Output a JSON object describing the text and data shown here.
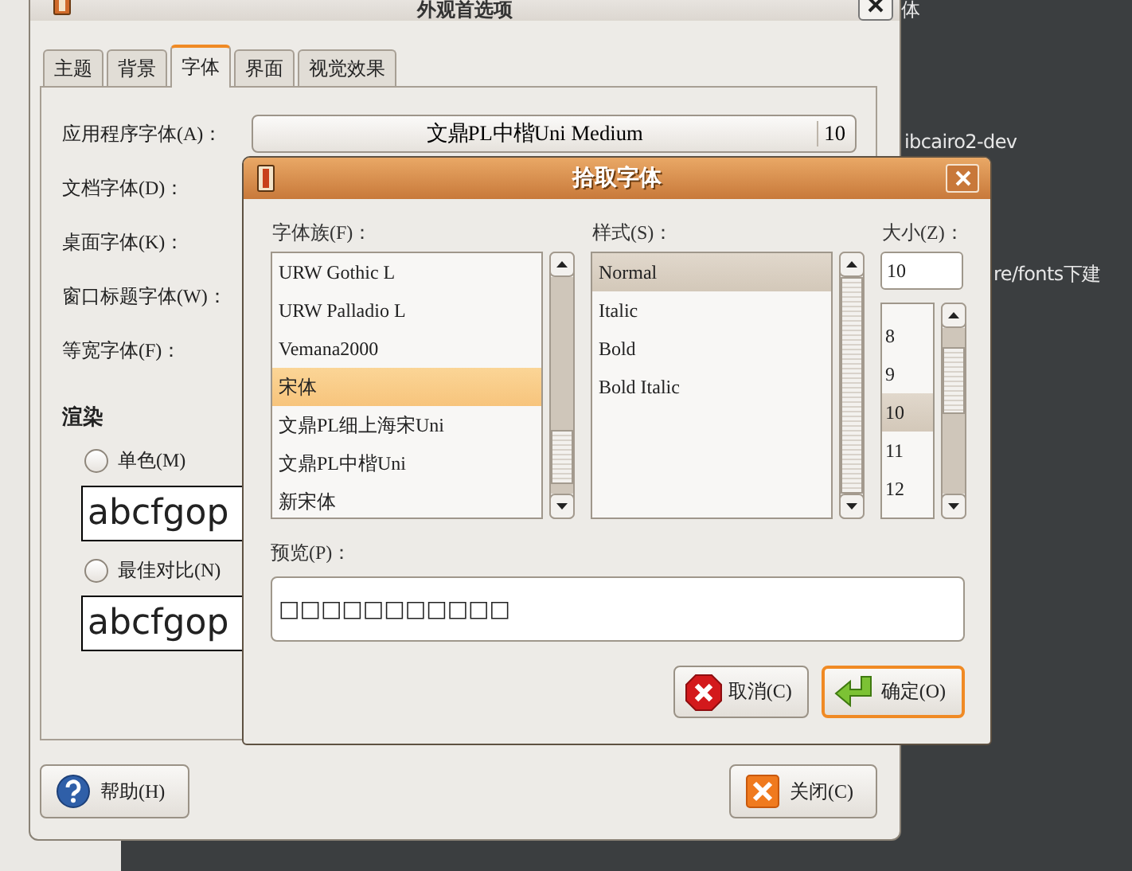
{
  "desktop_text": [
    "体",
    "ibcairo2-dev",
    "re/fonts下建"
  ],
  "main_window": {
    "title": "外观首选项",
    "tabs": [
      {
        "label": "主题",
        "selected": false
      },
      {
        "label": "背景",
        "selected": false
      },
      {
        "label": "字体",
        "selected": true
      },
      {
        "label": "界面",
        "selected": false
      },
      {
        "label": "视觉效果",
        "selected": false
      }
    ],
    "font_rows": [
      {
        "label": "应用程序字体(A)：",
        "value": "文鼎PL中楷Uni Medium",
        "size": "10"
      },
      {
        "label": "文档字体(D)："
      },
      {
        "label": "桌面字体(K)："
      },
      {
        "label": "窗口标题字体(W)："
      },
      {
        "label": "等宽字体(F)："
      }
    ],
    "rendering": {
      "heading": "渲染",
      "options": [
        {
          "label": "单色(M)",
          "selected": false,
          "sample": "abcfgop"
        },
        {
          "label": "最佳对比(N)",
          "selected": false,
          "sample": "abcfgop"
        }
      ]
    },
    "buttons": [
      {
        "label": "帮助(H)",
        "kind": "help"
      },
      {
        "label": "关闭(C)",
        "kind": "close"
      }
    ]
  },
  "dialog": {
    "title": "拾取字体",
    "family": {
      "label": "字体族(F)：",
      "items": [
        {
          "name": "URW Gothic L",
          "selected": false
        },
        {
          "name": "URW Palladio L",
          "selected": false
        },
        {
          "name": "Vemana2000",
          "selected": false
        },
        {
          "name": "宋体",
          "selected": true
        },
        {
          "name": "文鼎PL细上海宋Uni",
          "selected": false
        },
        {
          "name": "文鼎PL中楷Uni",
          "selected": false
        },
        {
          "name": "新宋体",
          "selected": false
        }
      ]
    },
    "style": {
      "label": "样式(S)：",
      "items": [
        {
          "name": "Normal",
          "selected": true
        },
        {
          "name": "Italic",
          "selected": false
        },
        {
          "name": "Bold",
          "selected": false
        },
        {
          "name": "Bold Italic",
          "selected": false
        }
      ]
    },
    "size": {
      "label": "大小(Z)：",
      "value": "10",
      "items": [
        {
          "name": "8",
          "selected": false
        },
        {
          "name": "9",
          "selected": false
        },
        {
          "name": "10",
          "selected": true
        },
        {
          "name": "11",
          "selected": false
        },
        {
          "name": "12",
          "selected": false
        }
      ]
    },
    "preview": {
      "label": "预览(P)：",
      "value": "□□□□□□□□□□□"
    },
    "buttons": [
      {
        "label": "取消(C)",
        "kind": "cancel",
        "default": false
      },
      {
        "label": "确定(O)",
        "kind": "ok",
        "default": true
      }
    ]
  }
}
